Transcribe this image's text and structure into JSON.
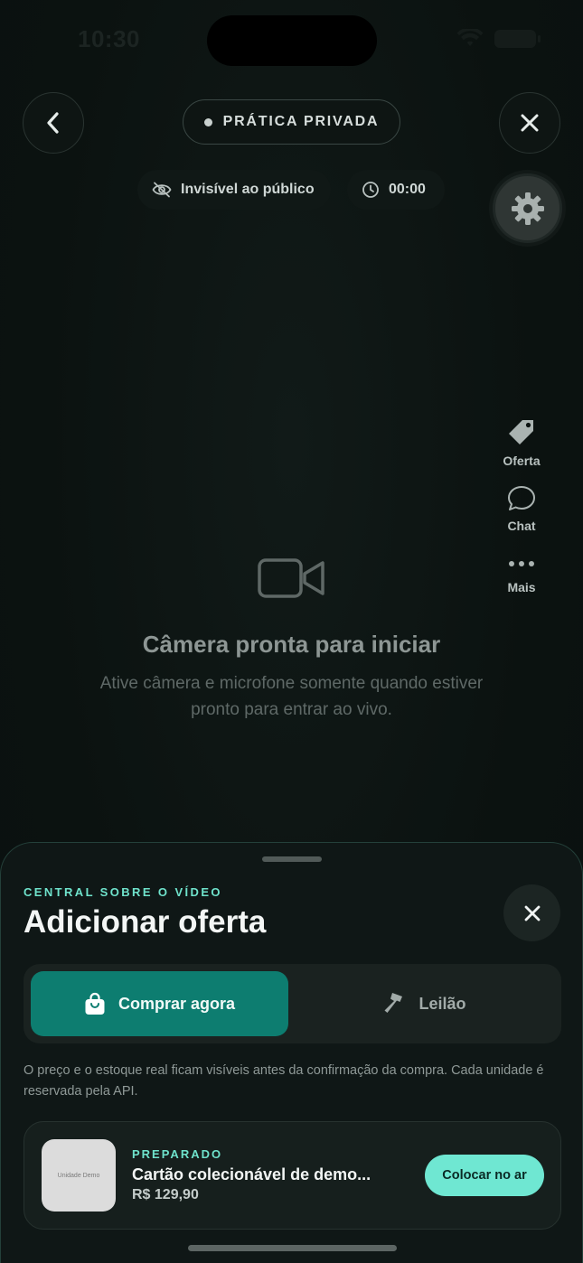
{
  "status_bar": {
    "time": "10:30"
  },
  "header": {
    "mode_label": "PRÁTICA PRIVADA",
    "visibility_label": "Invisível ao público",
    "timer": "00:00"
  },
  "side_rail": [
    {
      "label": "Oferta",
      "icon": "tag-icon"
    },
    {
      "label": "Chat",
      "icon": "chat-icon"
    },
    {
      "label": "Mais",
      "icon": "more-icon"
    }
  ],
  "camera": {
    "title": "Câmera pronta para iniciar",
    "subtitle": "Ative câmera e microfone somente quando estiver pronto para entrar ao vivo."
  },
  "sheet": {
    "eyebrow": "CENTRAL SOBRE O VÍDEO",
    "title": "Adicionar oferta",
    "tabs": [
      {
        "label": "Comprar agora",
        "icon": "shopping-bag-icon",
        "active": true
      },
      {
        "label": "Leilão",
        "icon": "hammer-icon",
        "active": false
      }
    ],
    "note": "O preço e o estoque real ficam visíveis antes da confirmação da compra. Cada unidade é reservada pela API.",
    "product": {
      "thumb_label": "Unidade Demo",
      "status": "PREPARADO",
      "name": "Cartão colecionável de demo...",
      "price": "R$ 129,90",
      "action_label": "Colocar no ar"
    }
  },
  "colors": {
    "accent": "#6fe3cc",
    "active_tab": "#0d7d70",
    "background": "#0c1311"
  }
}
